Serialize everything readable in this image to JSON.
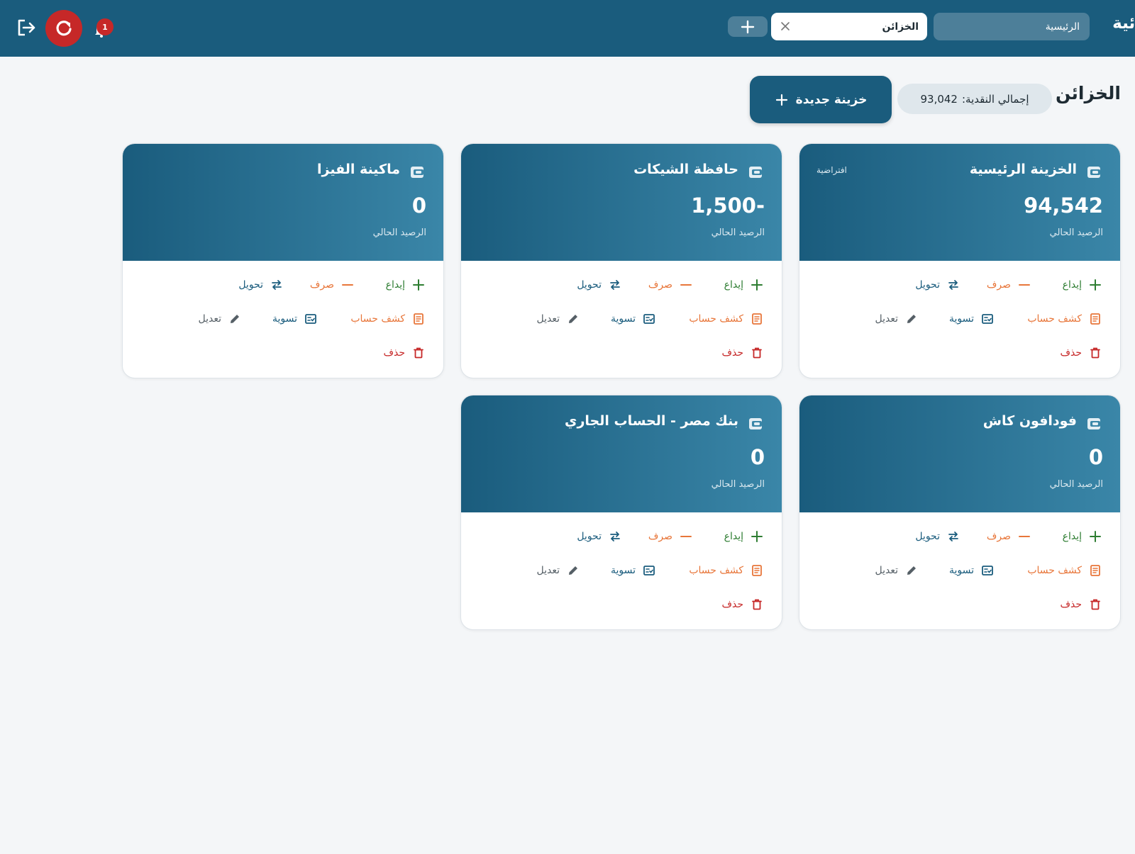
{
  "topbar": {
    "brand": "ائية",
    "tab_home": "الرئيسية",
    "tab_safes": "الخزائن",
    "notification_count": "1"
  },
  "page": {
    "title": "الخزائن",
    "total_label": "إجمالي النقدية:",
    "total_value": "93,042",
    "new_safe_label": "خزينة جديدة"
  },
  "card_common": {
    "balance_label": "الرصيد الحالي",
    "deposit": "إيداع",
    "withdraw": "صرف",
    "transfer": "تحويل",
    "statement": "كشف حساب",
    "reconcile": "تسوية",
    "edit": "تعديل",
    "delete": "حذف"
  },
  "cards": [
    {
      "name": "الخزينة الرئيسية",
      "balance": "94,542",
      "badge": "افتراضية"
    },
    {
      "name": "حافظة الشيكات",
      "balance": "1,500-",
      "badge": ""
    },
    {
      "name": "ماكينة الفيزا",
      "balance": "0",
      "badge": ""
    },
    {
      "name": "فودافون كاش",
      "balance": "0",
      "badge": ""
    },
    {
      "name": "بنك مصر - الحساب الجاري",
      "balance": "0",
      "badge": ""
    }
  ],
  "colors": {
    "primary": "#1a5c7d",
    "primary_light": "#3a86a8",
    "deposit": "#2e7d32",
    "withdraw": "#e8763a",
    "danger": "#c62828",
    "background": "#f4f6f8"
  }
}
